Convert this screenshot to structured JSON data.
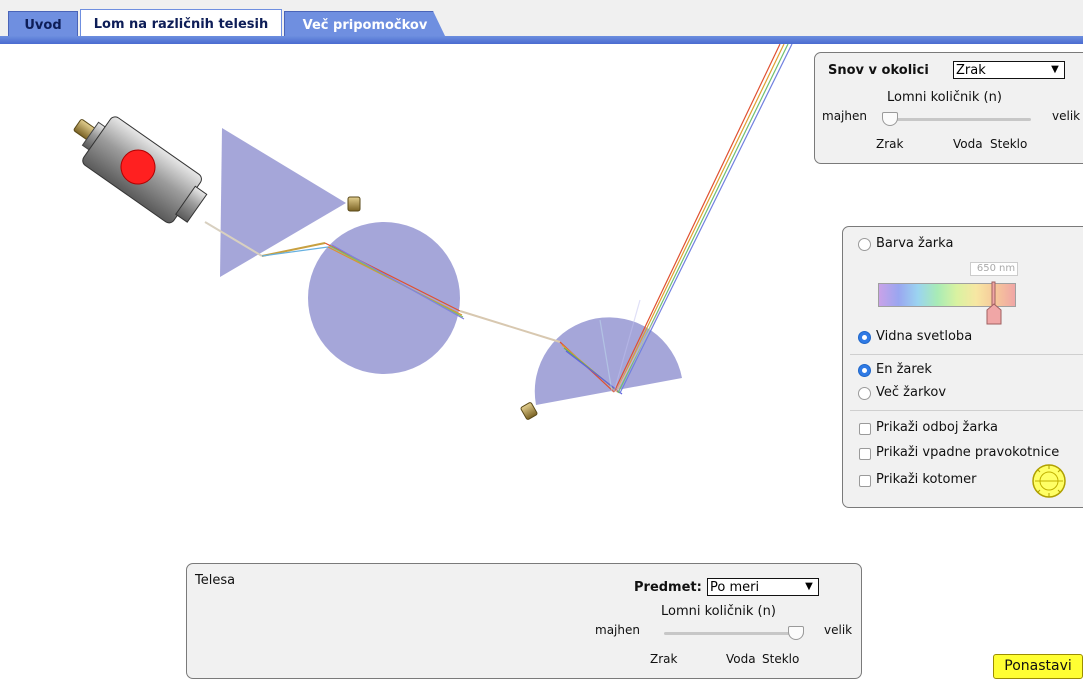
{
  "tabs": [
    {
      "label": "Uvod"
    },
    {
      "label": "Lom na različnih telesih"
    },
    {
      "label": "Več pripomočkov"
    }
  ],
  "environment": {
    "title": "Snov v okolici",
    "selected": "Zrak",
    "index_label": "Lomni količnik (n)",
    "low": "majhen",
    "high": "velik",
    "tick_air": "Zrak",
    "tick_water": "Voda",
    "tick_glass": "Steklo",
    "slider_fraction": 0.05
  },
  "options": {
    "ray_color": "Barva žarka",
    "wavelength_value": "650",
    "wavelength_unit": "nm",
    "visible_light": "Vidna svetloba",
    "one_ray": "En žarek",
    "many_rays": "Več žarkov",
    "show_reflections": "Prikaži odboj žarka",
    "show_normals": "Prikaži vpadne pravokotnice",
    "show_protractor": "Prikaži kotomer",
    "ray_color_selected": false,
    "visible_light_selected": true,
    "one_ray_selected": true,
    "many_rays_selected": false,
    "reflections_checked": false,
    "normals_checked": false,
    "protractor_checked": false
  },
  "objects": {
    "title": "Telesa",
    "object_label": "Predmet:",
    "selected": "Po meri",
    "index_label": "Lomni količnik (n)",
    "low": "majhen",
    "high": "velik",
    "tick_air": "Zrak",
    "tick_water": "Voda",
    "tick_glass": "Steklo",
    "slider_fraction": 0.95
  },
  "reset_label": "Ponastavi",
  "colors": {
    "tab_active_bg": "#ffffff",
    "tab_inactive_bg": "#6f8fe0",
    "tab_line": "#4a6bd0",
    "shape_fill": "#8f90cf",
    "reset_bg": "#ffff33",
    "laser_button": "#ff2020"
  }
}
